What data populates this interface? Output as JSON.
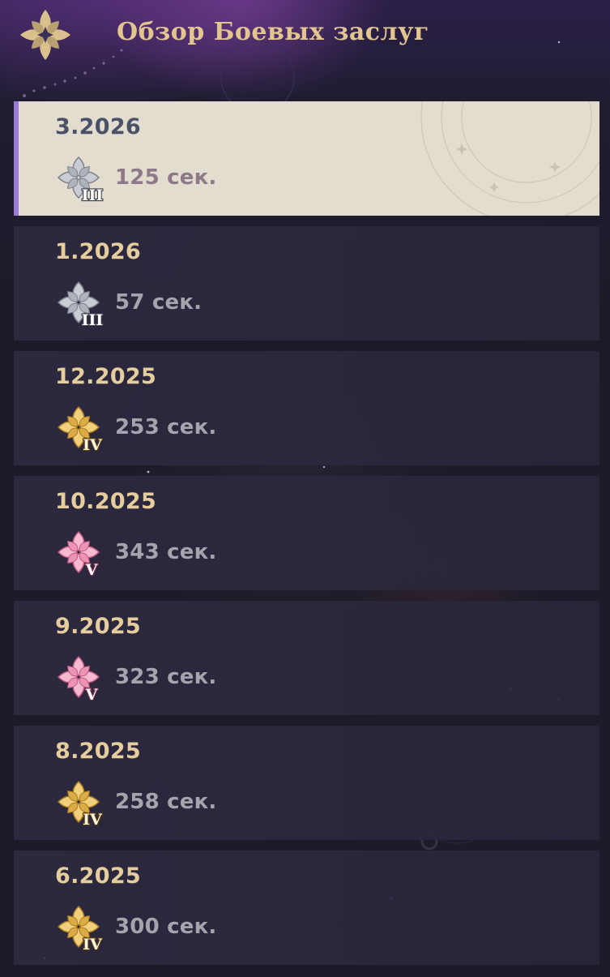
{
  "header": {
    "title": "Обзор Боевых заслуг",
    "logo_icon": "flower-emblem-icon"
  },
  "colors": {
    "title_gold": "#e2c58f",
    "selected_bg": "#e3ddd0",
    "selected_accent": "#9b7ad9",
    "card_bg": "#2c2940"
  },
  "records": [
    {
      "date": "3.2026",
      "time": "125 сек.",
      "medal": "silver",
      "rank": "III",
      "selected": true
    },
    {
      "date": "1.2026",
      "time": "57 сек.",
      "medal": "silver",
      "rank": "III",
      "selected": false
    },
    {
      "date": "12.2025",
      "time": "253 сек.",
      "medal": "gold",
      "rank": "IV",
      "selected": false
    },
    {
      "date": "10.2025",
      "time": "343 сек.",
      "medal": "pink",
      "rank": "V",
      "selected": false
    },
    {
      "date": "9.2025",
      "time": "323 сек.",
      "medal": "pink",
      "rank": "V",
      "selected": false
    },
    {
      "date": "8.2025",
      "time": "258 сек.",
      "medal": "gold",
      "rank": "IV",
      "selected": false
    },
    {
      "date": "6.2025",
      "time": "300 сек.",
      "medal": "gold",
      "rank": "IV",
      "selected": false
    }
  ]
}
